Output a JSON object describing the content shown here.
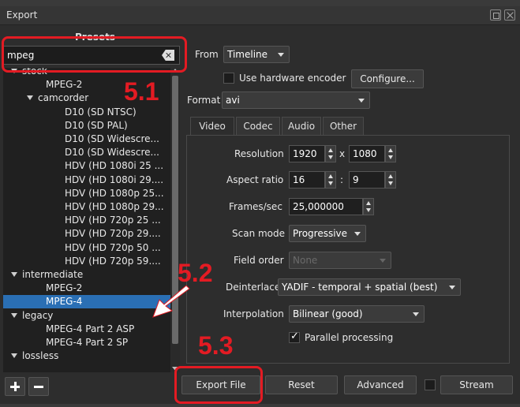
{
  "window": {
    "title": "Export"
  },
  "presets": {
    "header": "Presets",
    "search_value": "mpeg",
    "tree": [
      {
        "label": "stock",
        "indent": 0,
        "expanded": true
      },
      {
        "label": "MPEG-2",
        "indent": 1
      },
      {
        "label": "camcorder",
        "indent": 1,
        "expanded": true
      },
      {
        "label": "D10 (SD NTSC)",
        "indent": 2
      },
      {
        "label": "D10 (SD PAL)",
        "indent": 2
      },
      {
        "label": "D10 (SD Widescre...",
        "indent": 2
      },
      {
        "label": "D10 (SD Widescre...",
        "indent": 2
      },
      {
        "label": "HDV (HD 1080i 25 ...",
        "indent": 2
      },
      {
        "label": "HDV (HD 1080i 29....",
        "indent": 2
      },
      {
        "label": "HDV (HD 1080p 25...",
        "indent": 2
      },
      {
        "label": "HDV (HD 1080p 29...",
        "indent": 2
      },
      {
        "label": "HDV (HD 720p 25 ...",
        "indent": 2
      },
      {
        "label": "HDV (HD 720p 29....",
        "indent": 2
      },
      {
        "label": "HDV (HD 720p 50 ...",
        "indent": 2
      },
      {
        "label": "HDV (HD 720p 59....",
        "indent": 2
      },
      {
        "label": "intermediate",
        "indent": 0,
        "expanded": true
      },
      {
        "label": "MPEG-2",
        "indent": 1
      },
      {
        "label": "MPEG-4",
        "indent": 1,
        "selected": true
      },
      {
        "label": "legacy",
        "indent": 0,
        "expanded": true
      },
      {
        "label": "MPEG-4 Part 2 ASP",
        "indent": 1
      },
      {
        "label": "MPEG-4 Part 2 SP",
        "indent": 1
      },
      {
        "label": "lossless",
        "indent": 0,
        "expanded": true
      }
    ]
  },
  "from": {
    "label": "From",
    "value": "Timeline"
  },
  "hw": {
    "label": "Use hardware encoder",
    "checked": false,
    "configure_label": "Configure..."
  },
  "format": {
    "label": "Format",
    "value": "avi"
  },
  "tabs": [
    "Video",
    "Codec",
    "Audio",
    "Other"
  ],
  "video": {
    "resolution_label": "Resolution",
    "width": "1920",
    "x_sep": "x",
    "height": "1080",
    "aspect_label": "Aspect ratio",
    "aspect_w": "16",
    "colon_sep": ":",
    "aspect_h": "9",
    "fps_label": "Frames/sec",
    "fps": "25,000000",
    "scan_label": "Scan mode",
    "scan": "Progressive",
    "field_label": "Field order",
    "field": "None",
    "deint_label": "Deinterlacer",
    "deint": "YADIF - temporal + spatial (best)",
    "interp_label": "Interpolation",
    "interp": "Bilinear (good)",
    "parallel_label": "Parallel processing",
    "parallel": true
  },
  "buttons": {
    "export": "Export File",
    "reset": "Reset",
    "advanced": "Advanced",
    "stream": "Stream"
  },
  "annotations": {
    "a1": "5.1",
    "a2": "5.2",
    "a3": "5.3",
    "color": "#e31b23"
  },
  "colors": {
    "selection": "#2a6fb4",
    "panel": "#2d2d2d"
  }
}
